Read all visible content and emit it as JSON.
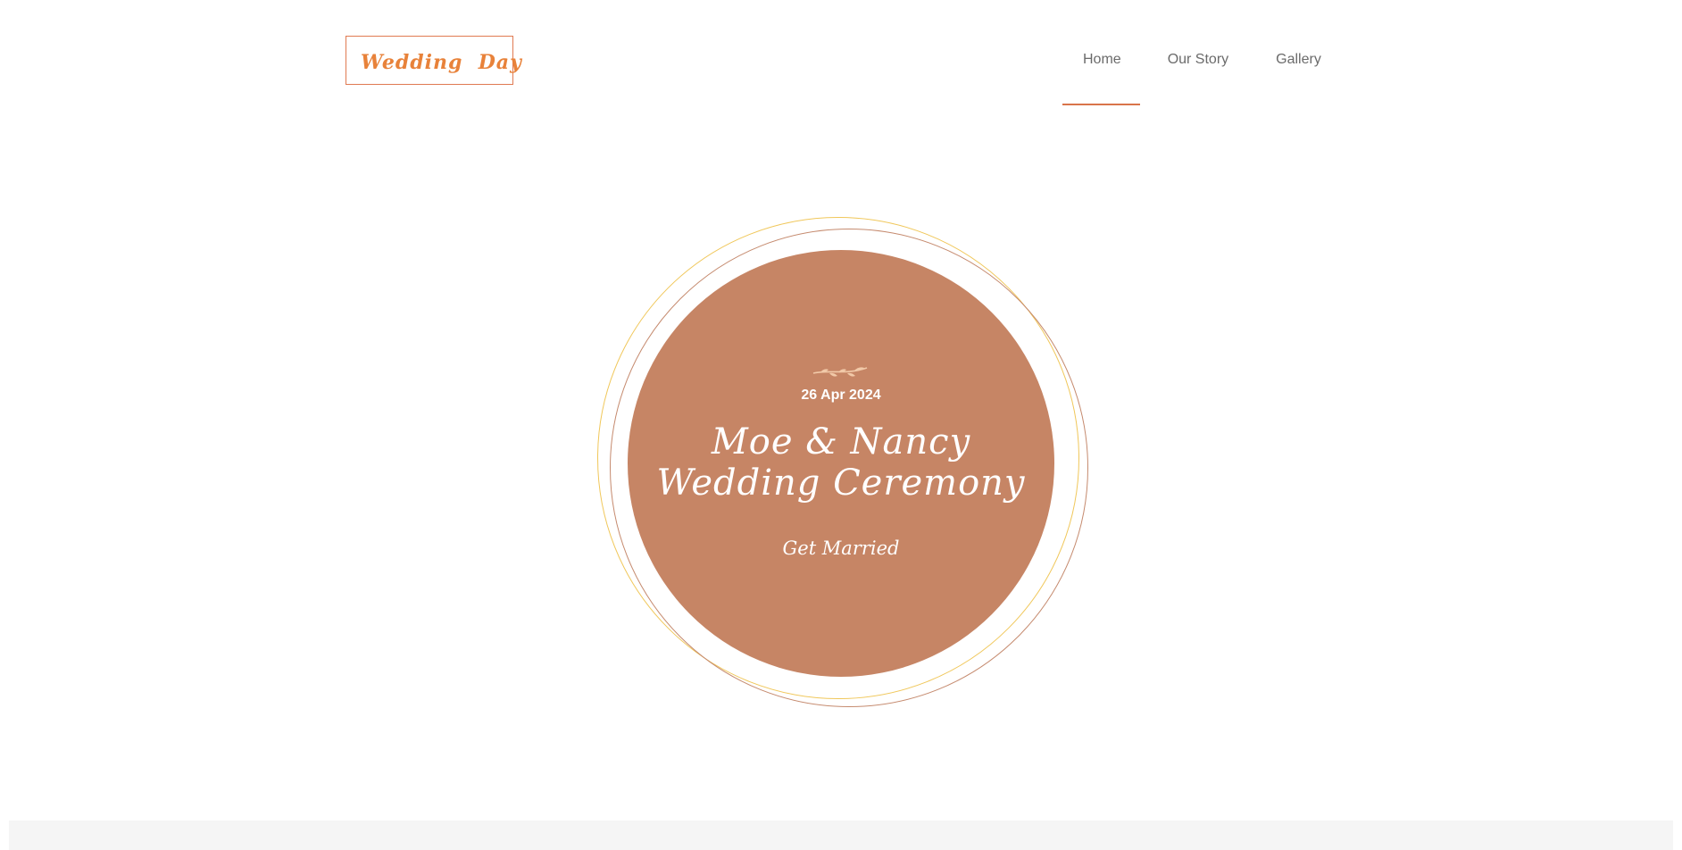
{
  "header": {
    "logo_text": "Wedding  Day",
    "nav": {
      "home": "Home",
      "our_story": "Our Story",
      "gallery": "Gallery",
      "active": "Home"
    }
  },
  "hero": {
    "ornament_icon": "leaf-ornament-icon",
    "date": "26 Apr 2024",
    "title_line1": "Moe & Nancy",
    "title_line2": "Wedding Ceremony",
    "subtitle": "Get Married"
  },
  "colors": {
    "accent": "#e07a52",
    "logo": "#e8823a",
    "disc": "#c68565",
    "ring_gold": "#f0c75a",
    "ring_brown": "#c58a6e",
    "nav_text": "#6b6b6b",
    "footer_bg": "#f5f5f5"
  }
}
